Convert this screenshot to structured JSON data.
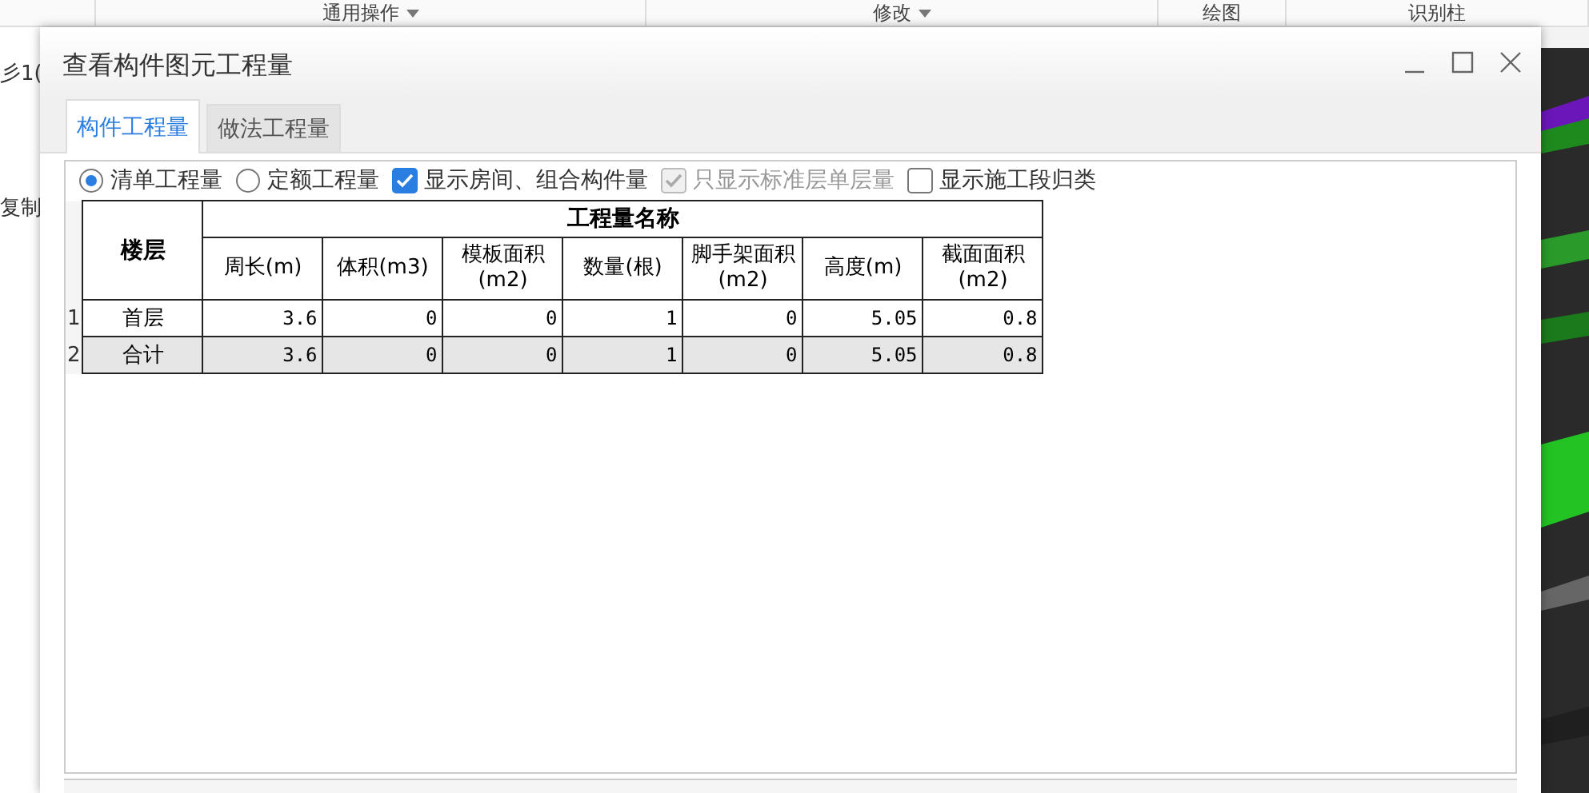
{
  "background_app": {
    "toolbar": [
      {
        "label": "通用操作",
        "dropdown": true
      },
      {
        "label": "修改",
        "dropdown": true
      },
      {
        "label": "绘图",
        "dropdown": false
      },
      {
        "label": "识别柱",
        "dropdown": false
      }
    ],
    "side_texts": [
      "彡1(",
      "复制"
    ]
  },
  "dialog": {
    "title": "查看构件图元工程量",
    "tabs": [
      {
        "label": "构件工程量",
        "selected": true
      },
      {
        "label": "做法工程量",
        "selected": false
      }
    ],
    "options": [
      {
        "kind": "radio",
        "label": "清单工程量",
        "selected": true
      },
      {
        "kind": "radio",
        "label": "定额工程量",
        "selected": false
      },
      {
        "kind": "checkbox",
        "label": "显示房间、组合构件量",
        "checked": true,
        "disabled": false
      },
      {
        "kind": "checkbox",
        "label": "只显示标准层单层量",
        "checked": true,
        "disabled": true
      },
      {
        "kind": "checkbox",
        "label": "显示施工段归类",
        "checked": false,
        "disabled": false
      }
    ],
    "table": {
      "row_header": "楼层",
      "group_header": "工程量名称",
      "columns": [
        "周长(m)",
        "体积(m3)",
        "模板面积(m2)",
        "数量(根)",
        "脚手架面积(m2)",
        "高度(m)",
        "截面面积(m2)"
      ],
      "rows": [
        {
          "number": "1",
          "floor": "首层",
          "values": [
            "3.6",
            "0",
            "0",
            "1",
            "0",
            "5.05",
            "0.8"
          ],
          "total": false
        },
        {
          "number": "2",
          "floor": "合计",
          "values": [
            "3.6",
            "0",
            "0",
            "1",
            "0",
            "5.05",
            "0.8"
          ],
          "total": true
        }
      ]
    }
  }
}
